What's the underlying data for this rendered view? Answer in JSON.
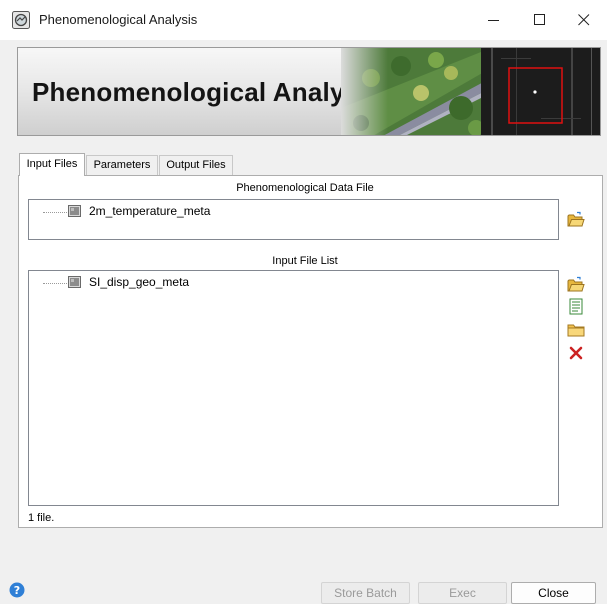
{
  "window": {
    "title": "Phenomenological Analysis",
    "controls": {
      "minimize": "—",
      "maximize": "☐",
      "close": "✕"
    }
  },
  "banner": {
    "title": "Phenomenological Analysis"
  },
  "tabs": [
    {
      "label": "Input Files",
      "active": true
    },
    {
      "label": "Parameters",
      "active": false
    },
    {
      "label": "Output Files",
      "active": false
    }
  ],
  "data_file": {
    "label": "Phenomenological Data File",
    "item": "2m_temperature_meta"
  },
  "input_list": {
    "label": "Input File List",
    "items": [
      "SI_disp_geo_meta"
    ],
    "count_text": "1 file."
  },
  "icons": {
    "open": "open-folder-icon",
    "add": "open-folder-icon",
    "list": "text-file-icon",
    "folder": "folder-icon",
    "remove": "red-x-icon",
    "help": "help-icon"
  },
  "colors": {
    "accent": "#2f7fd6",
    "remove": "#cc2222",
    "folder": "#f2c14e"
  },
  "buttons": {
    "store_batch": "Store Batch",
    "exec": "Exec",
    "close": "Close"
  }
}
